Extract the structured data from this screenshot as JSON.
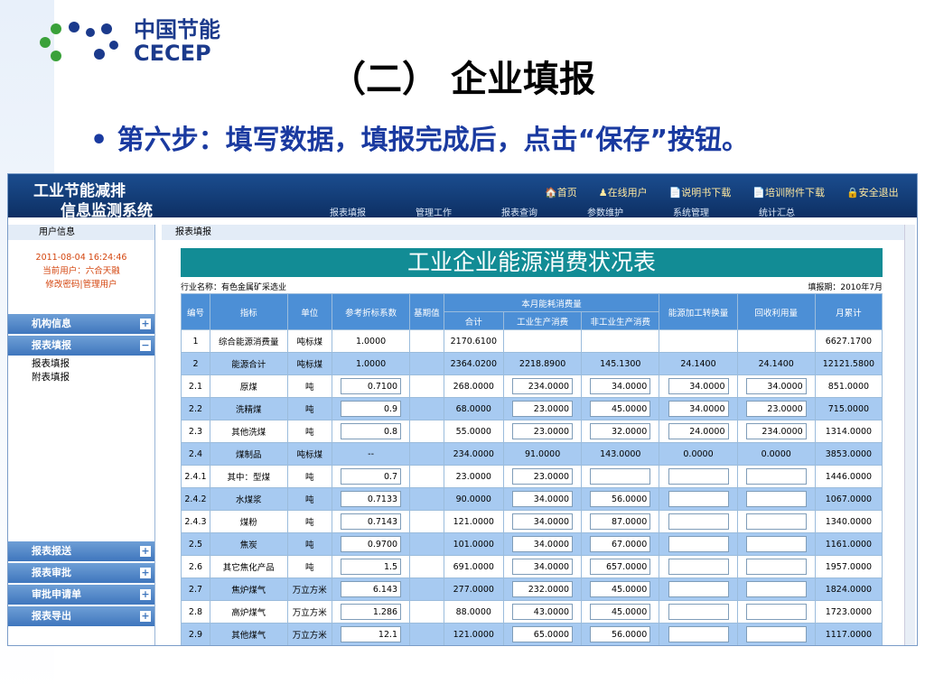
{
  "slide": {
    "logo_cn": "中国节能",
    "logo_en": "CECEP",
    "title": "（二） 企业填报",
    "bullet": "第六步：填写数据，填报完成后，点击“保存”按钮。"
  },
  "app": {
    "sys1": "工业节能减排",
    "sys2": "信息监测系统",
    "top_links": [
      "🏠首页",
      "♟在线用户",
      "📄说明书下载",
      "📄培训附件下载",
      "🔒安全退出"
    ],
    "nav": [
      "报表填报",
      "管理工作",
      "报表查询",
      "参数维护",
      "系统管理",
      "统计汇总"
    ],
    "sidebar": {
      "head": "用户信息",
      "time": "2011-08-04 16:24:46",
      "user": "当前用户：六合天融",
      "links": "修改密码|管理用户",
      "top_menus": [
        {
          "label": "机构信息",
          "sign": "+"
        },
        {
          "label": "报表填报",
          "sign": "−"
        }
      ],
      "subs": [
        "报表填报",
        "附表填报"
      ],
      "bottom_menus": [
        {
          "label": "报表报送",
          "sign": "+"
        },
        {
          "label": "报表审批",
          "sign": "+"
        },
        {
          "label": "审批申请单",
          "sign": "+"
        },
        {
          "label": "报表导出",
          "sign": "+"
        }
      ]
    },
    "crumb": "报表填报",
    "table_title": "工业企业能源消费状况表",
    "industry": "行业名称：有色金属矿采选业",
    "period": "填报期：2010年7月",
    "h1": [
      "编号",
      "指标",
      "单位",
      "参考折标系数",
      "基期值",
      "本月能耗消费量",
      "能源加工转换量",
      "回收利用量",
      "月累计"
    ],
    "h2": [
      "合计",
      "工业生产消费",
      "非工业生产消费"
    ],
    "rows": [
      [
        "1",
        "综合能源消费量",
        "吨标煤",
        "1.0000",
        "",
        "2170.6100",
        "",
        "",
        "",
        "",
        "6627.1700"
      ],
      [
        "2",
        "能源合计",
        "吨标煤",
        "1.0000",
        "",
        "2364.0200",
        "2218.8900",
        "145.1300",
        "24.1400",
        "24.1400",
        "12121.5800"
      ],
      [
        "2.1",
        "原煤",
        "吨",
        "0.7100",
        "",
        "268.0000",
        "234.0000",
        "34.0000",
        "34.0000",
        "34.0000",
        "851.0000"
      ],
      [
        "2.2",
        "洗精煤",
        "吨",
        "0.9",
        "",
        "68.0000",
        "23.0000",
        "45.0000",
        "34.0000",
        "23.0000",
        "715.0000"
      ],
      [
        "2.3",
        "其他洗煤",
        "吨",
        "0.8",
        "",
        "55.0000",
        "23.0000",
        "32.0000",
        "24.0000",
        "234.0000",
        "1314.0000"
      ],
      [
        "2.4",
        "煤制品",
        "吨标煤",
        "--",
        "",
        "234.0000",
        "91.0000",
        "143.0000",
        "0.0000",
        "0.0000",
        "3853.0000"
      ],
      [
        "2.4.1",
        "其中：型煤",
        "吨",
        "0.7",
        "",
        "23.0000",
        "23.0000",
        "",
        "",
        "",
        "1446.0000"
      ],
      [
        "2.4.2",
        "水煤浆",
        "吨",
        "0.7133",
        "",
        "90.0000",
        "34.0000",
        "56.0000",
        "",
        "",
        "1067.0000"
      ],
      [
        "2.4.3",
        "煤粉",
        "吨",
        "0.7143",
        "",
        "121.0000",
        "34.0000",
        "87.0000",
        "",
        "",
        "1340.0000"
      ],
      [
        "2.5",
        "焦炭",
        "吨",
        "0.9700",
        "",
        "101.0000",
        "34.0000",
        "67.0000",
        "",
        "",
        "1161.0000"
      ],
      [
        "2.6",
        "其它焦化产品",
        "吨",
        "1.5",
        "",
        "691.0000",
        "34.0000",
        "657.0000",
        "",
        "",
        "1957.0000"
      ],
      [
        "2.7",
        "焦炉煤气",
        "万立方米",
        "6.143",
        "",
        "277.0000",
        "232.0000",
        "45.0000",
        "",
        "",
        "1824.0000"
      ],
      [
        "2.8",
        "高炉煤气",
        "万立方米",
        "1.286",
        "",
        "88.0000",
        "43.0000",
        "45.0000",
        "",
        "",
        "1723.0000"
      ],
      [
        "2.9",
        "其他煤气",
        "万立方米",
        "12.1",
        "",
        "121.0000",
        "65.0000",
        "56.0000",
        "",
        "",
        "1117.0000"
      ]
    ]
  }
}
